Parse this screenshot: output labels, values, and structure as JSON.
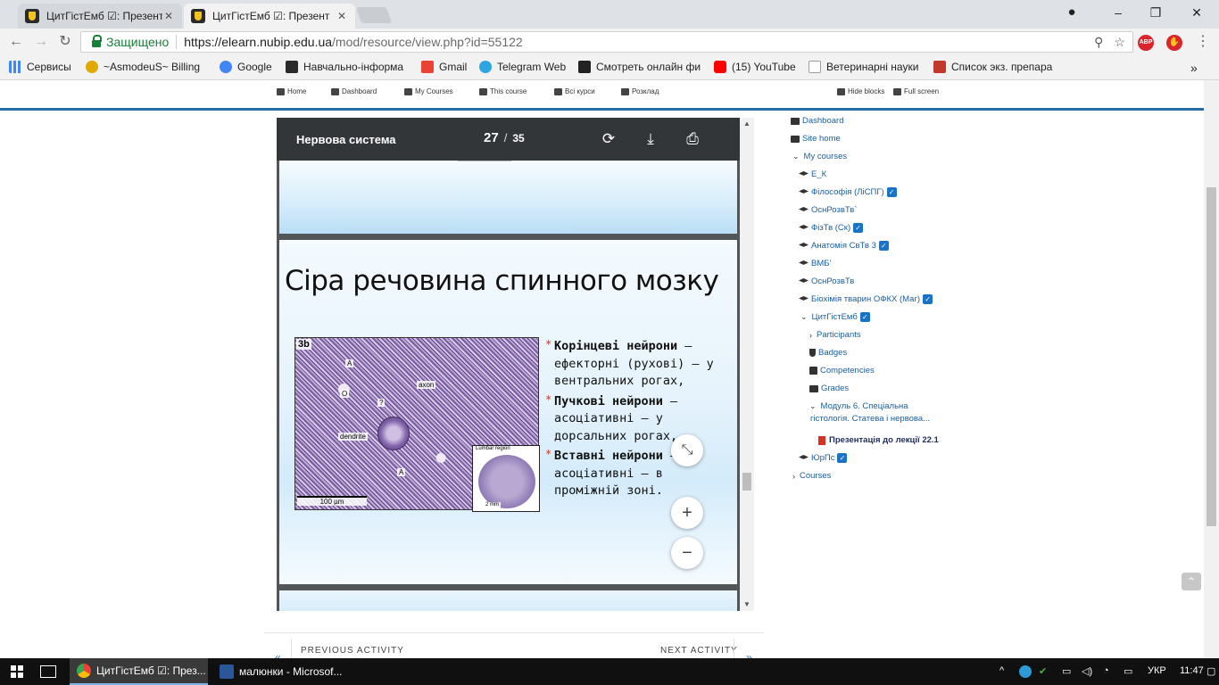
{
  "browser": {
    "tabs": [
      {
        "title": "ЦитГістЕмб ☑: Презент",
        "active": false
      },
      {
        "title": "ЦитГістЕмб ☑: Презент",
        "active": true
      }
    ],
    "window_controls": [
      "–",
      "❐",
      "✕"
    ],
    "profile_icon": "user-icon",
    "secure_label": "Защищено",
    "url_host": "https://elearn.nubip.edu.ua",
    "url_path": "/mod/resource/view.php?id=55122",
    "extensions": [
      {
        "name": "adblock",
        "label": "ABP",
        "color": "#d9252b"
      },
      {
        "name": "stop",
        "label": "✋",
        "color": "#d9252b"
      }
    ],
    "bookmarks": [
      {
        "label": "Сервисы",
        "icon": "apps-icon",
        "color": "#4285f4"
      },
      {
        "label": "~AsmodeuS~ Billing",
        "icon": "c-icon",
        "color": "#e0a800"
      },
      {
        "label": "Google",
        "icon": "google-icon",
        "color": "#4285f4"
      },
      {
        "label": "Навчально-інформа",
        "icon": "nubip-icon",
        "color": "#2a2a2a"
      },
      {
        "label": "Gmail",
        "icon": "gmail-icon",
        "color": "#ea4335"
      },
      {
        "label": "Telegram Web",
        "icon": "telegram-icon",
        "color": "#2ca5e0"
      },
      {
        "label": "Смотреть онлайн фи",
        "icon": "hd-icon",
        "color": "#222222"
      },
      {
        "label": "(15) YouTube",
        "icon": "youtube-icon",
        "color": "#ff0000"
      },
      {
        "label": "Ветеринарні науки",
        "icon": "page-icon",
        "color": "#9e9e9e"
      },
      {
        "label": "Список экз. препара",
        "icon": "c2-icon",
        "color": "#c0392b"
      }
    ],
    "bookmarks_more": "»"
  },
  "course_nav": {
    "items": [
      "Home",
      "Dashboard",
      "My Courses",
      "This course",
      "Всі курси",
      "Розклад"
    ],
    "hide_blocks": "Hide blocks",
    "full_screen": "Full screen"
  },
  "viewer": {
    "doc_title": "Нервова система",
    "page_current": "27",
    "page_separator": "/",
    "page_total": "35",
    "zoom_fit_icon": "⤡",
    "zoom_in_label": "+",
    "zoom_out_label": "−"
  },
  "slide": {
    "title": "Сіра речовина спинного мозку",
    "figure_labels": {
      "panel": "3b",
      "axon": "axon",
      "dendrite": "dendrite",
      "scale": "100 µm",
      "inset_caption": "Lumbar region",
      "inset_scale": "2 mm",
      "mark_a": "A",
      "mark_o": "O",
      "mark_q": "?"
    },
    "bullets": [
      {
        "bold": "Корінцеві нейрони",
        "rest": " – ефекторні (рухові) – у вентральних рогах,"
      },
      {
        "bold": "Пучкові нейрони",
        "rest": " – асоціативні – у дорсальних рогах,"
      },
      {
        "bold": "Вставні нейрони",
        "rest": " – асоціативні – в проміжній зоні."
      }
    ],
    "bullet_marker": "*"
  },
  "activity_nav": {
    "previous": "PREVIOUS ACTIVITY",
    "next": "NEXT ACTIVITY"
  },
  "navigation_block": {
    "items": [
      {
        "label": "Dashboard",
        "icon": "dashboard-icon",
        "indent": 0,
        "chevron": ""
      },
      {
        "label": "Site home",
        "icon": "home-icon",
        "indent": 0,
        "chevron": ""
      },
      {
        "label": "My courses",
        "icon": "",
        "indent": 0,
        "chevron": "⌄"
      },
      {
        "label": "Е_К",
        "icon": "cap-icon",
        "indent": 1,
        "check": false
      },
      {
        "label": "Філософія (ЛіСПГ)",
        "icon": "cap-icon",
        "indent": 1,
        "check": true
      },
      {
        "label": "ОснРозвТв`",
        "icon": "cap-icon",
        "indent": 1,
        "check": false
      },
      {
        "label": "ФізТв (Ск)",
        "icon": "cap-icon",
        "indent": 1,
        "check": true
      },
      {
        "label": "Анатомія СвТв 3",
        "icon": "cap-icon",
        "indent": 1,
        "check": true
      },
      {
        "label": "ВМБ'",
        "icon": "cap-icon",
        "indent": 1,
        "check": false
      },
      {
        "label": "ОснРозвТв",
        "icon": "cap-icon",
        "indent": 1,
        "check": false
      },
      {
        "label": "Біохімія тварин ОФКХ (Маг)",
        "icon": "cap-icon",
        "indent": 1,
        "check": true
      },
      {
        "label": "ЦитГістЕмб",
        "icon": "",
        "indent": 1,
        "chevron": "⌄",
        "check": true
      },
      {
        "label": "Participants",
        "icon": "",
        "indent": 2,
        "chevron": "›"
      },
      {
        "label": "Badges",
        "icon": "shield-icon",
        "indent": 2
      },
      {
        "label": "Competencies",
        "icon": "checkbox-icon",
        "indent": 2
      },
      {
        "label": "Grades",
        "icon": "table-icon",
        "indent": 2
      },
      {
        "label": "Модуль 6. Спеціальна",
        "icon": "",
        "indent": 2,
        "chevron": "⌄"
      },
      {
        "label": "гістологія. Статева і нервова...",
        "icon": "",
        "indent": 2.5
      },
      {
        "label": "Презентація до лекції 22.1",
        "icon": "pdf-icon",
        "indent": 3,
        "current": true
      },
      {
        "label": "ЮрПс",
        "icon": "cap-icon",
        "indent": 1,
        "check": true
      },
      {
        "label": "Courses",
        "icon": "",
        "indent": 0,
        "chevron": "›"
      }
    ]
  },
  "taskbar": {
    "tasks": [
      {
        "label": "ЦитГістЕмб ☑: През...",
        "icon": "chrome-icon",
        "active": true
      },
      {
        "label": "малюнки - Microsof...",
        "icon": "word-icon",
        "active": false
      }
    ],
    "language": "УКР",
    "clock": "11:47"
  }
}
